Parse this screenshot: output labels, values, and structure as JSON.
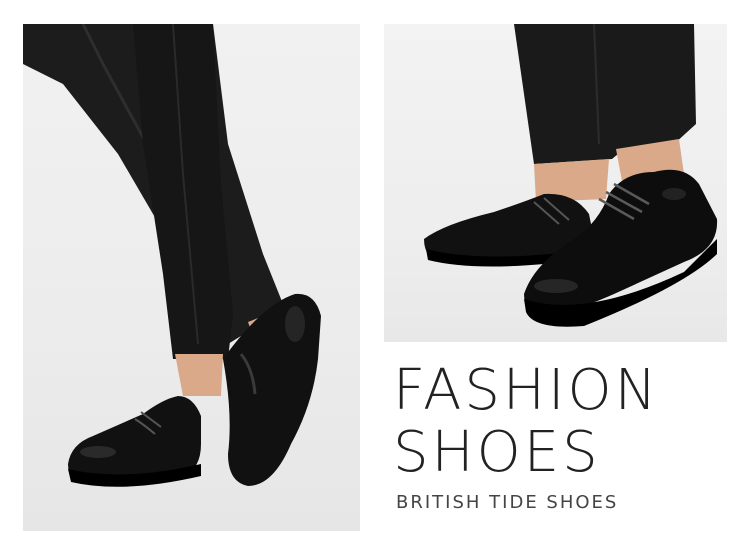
{
  "headline": {
    "line1": "FASHION",
    "line2": "SHOES"
  },
  "tagline": "BRITISH TIDE SHOES",
  "colors": {
    "background": "#ffffff",
    "photo_backdrop": "#ececec",
    "text": "#222222",
    "shoe_leather": "#111111",
    "trousers": "#1a1a1a",
    "skin": "#d9a98a"
  }
}
